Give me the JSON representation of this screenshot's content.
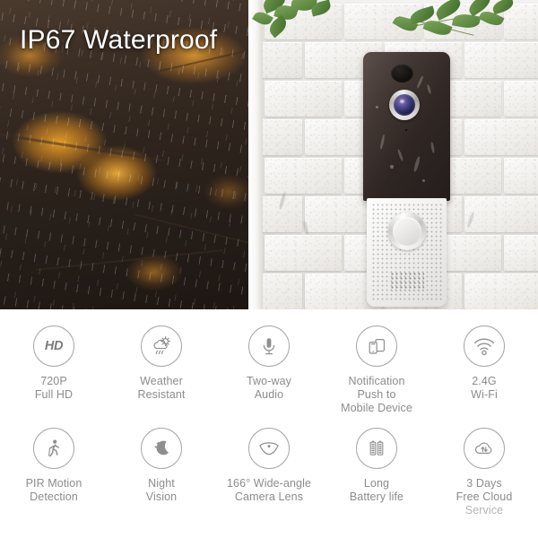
{
  "hero": {
    "title": "IP67 Waterproof",
    "left_photo": {
      "name": "rainy-autumn-leaves-photo",
      "description": "Rain falling over orange autumn beech leaves on dark background"
    },
    "right_photo": {
      "name": "doorbell-on-brick-wall-photo",
      "description": "Video doorbell mounted on white brick wall with green leaves above",
      "product": {
        "top_housing_color": "#332a26",
        "bottom_housing_color": "#f0efee",
        "lens_color": "#3b3a78",
        "parts": [
          "pir-sensor",
          "camera-lens",
          "microphone",
          "doorbell-button",
          "speaker-grille"
        ]
      }
    }
  },
  "features": {
    "rows": [
      [
        {
          "icon": "hd-badge-icon",
          "icon_text": "HD",
          "lines": [
            "720P",
            "Full HD"
          ]
        },
        {
          "icon": "weather-cloud-rain-sun-icon",
          "lines": [
            "Weather",
            "Resistant"
          ]
        },
        {
          "icon": "microphone-icon",
          "lines": [
            "Two-way",
            "Audio"
          ]
        },
        {
          "icon": "mobile-notification-icon",
          "lines": [
            "Notification",
            "Push to",
            "Mobile Device"
          ]
        },
        {
          "icon": "wifi-icon",
          "lines": [
            "2.4G",
            "Wi-Fi"
          ]
        }
      ],
      [
        {
          "icon": "walking-person-motion-icon",
          "lines": [
            "PIR Motion",
            "Detection"
          ]
        },
        {
          "icon": "moon-stars-icon",
          "lines": [
            "Night",
            "Vision"
          ]
        },
        {
          "icon": "wide-angle-lens-icon",
          "lines": [
            "166° Wide-angle",
            "Camera Lens"
          ]
        },
        {
          "icon": "battery-pair-icon",
          "lines": [
            "Long",
            "Battery life"
          ]
        },
        {
          "icon": "cloud-sync-icon",
          "lines": [
            "3 Days",
            "Free Cloud",
            "Service"
          ]
        }
      ]
    ]
  },
  "colors": {
    "icon_stroke": "#a6a6a6",
    "label_text": "#8c8c8c",
    "panel_background": "#ffffff",
    "title_text": "#ffffff"
  }
}
